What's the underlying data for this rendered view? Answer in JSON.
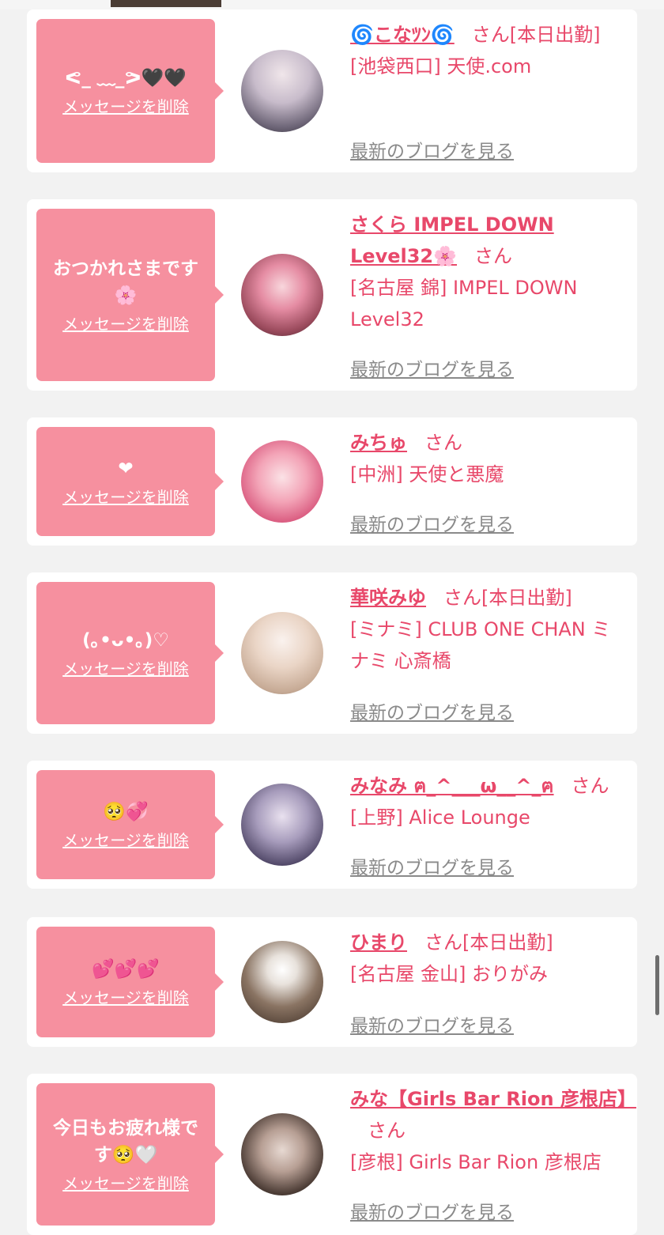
{
  "delete_label": "メッセージを削除",
  "blog_label": "最新のブログを見る",
  "san_label": "さん",
  "cards": [
    {
      "message": "ᕙ_ ﹏_ᕗ🖤🖤",
      "name": "🌀こなﾂﾝ🌀",
      "status": "[本日出勤]",
      "shop": "[池袋西口] 天使.com"
    },
    {
      "message": "おつかれさまです🌸",
      "name": "さくら IMPEL DOWN Level32🌸",
      "status": "",
      "shop": "[名古屋 錦] IMPEL DOWN Level32"
    },
    {
      "message": "❤",
      "name": "みちゅ",
      "status": "",
      "shop": "[中洲] 天使と悪魔"
    },
    {
      "message": "(｡•ᴗ•｡)♡",
      "name": "華咲みゆ",
      "status": "[本日出勤]",
      "shop": "[ミナミ] CLUB ONE CHAN ミナミ 心斎橋"
    },
    {
      "message": "🥺💞",
      "name": "みなみ ฅ_^___ω__^_ฅ",
      "status": "",
      "shop": "[上野] Alice Lounge"
    },
    {
      "message": "💕💕💕",
      "name": "ひまり",
      "status": "[本日出勤]",
      "shop": "[名古屋 金山] おりがみ"
    },
    {
      "message": "今日もお疲れ様です🥺🤍",
      "name": "みな【Girls Bar Rion 彦根店】",
      "status": "",
      "shop": "[彦根] Girls Bar Rion 彦根店"
    }
  ]
}
